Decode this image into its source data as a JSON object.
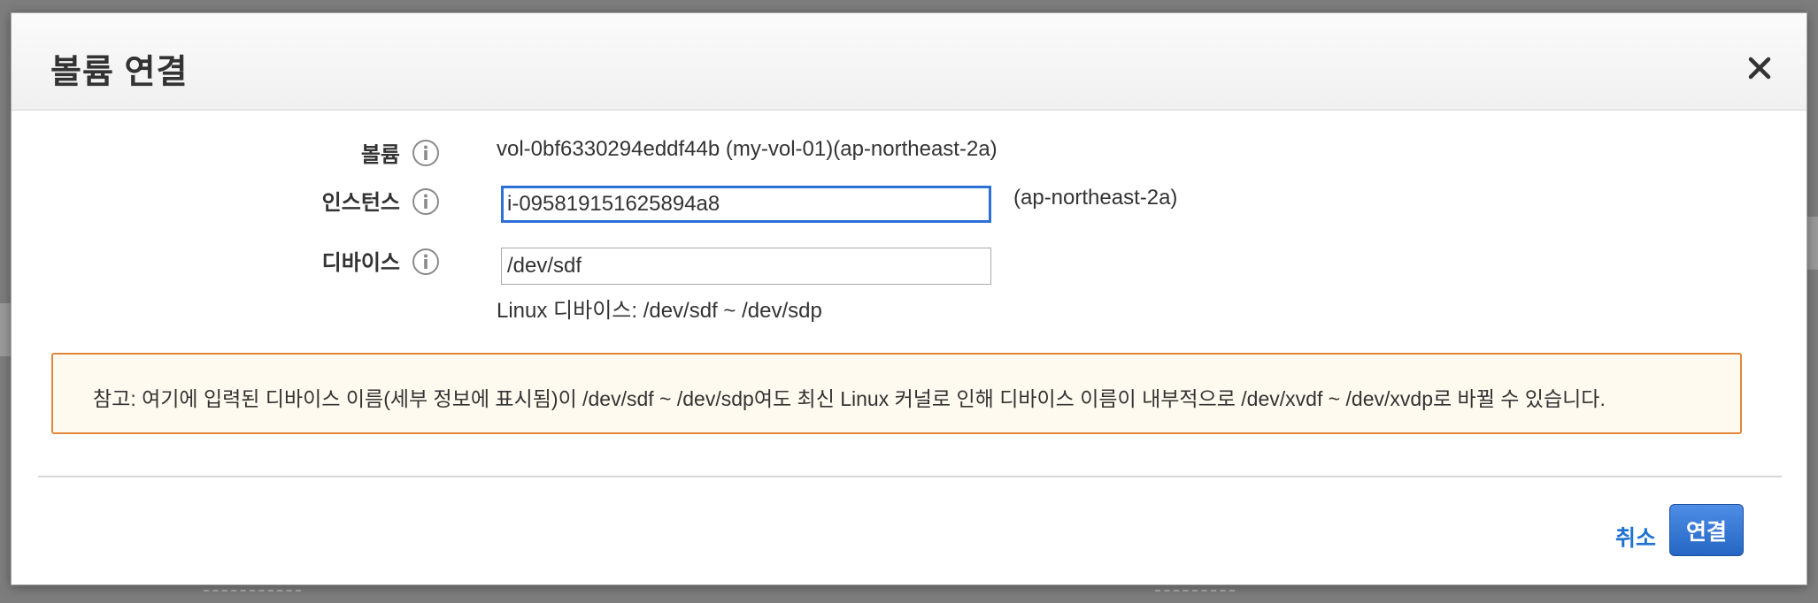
{
  "modal": {
    "title": "볼륨 연결",
    "close_label": "×"
  },
  "fields": {
    "volume": {
      "label": "볼륨",
      "value": "vol-0bf6330294eddf44b (my-vol-01)(ap-northeast-2a)"
    },
    "instance": {
      "label": "인스턴스",
      "value": "i-095819151625894a8",
      "zone": "(ap-northeast-2a)"
    },
    "device": {
      "label": "디바이스",
      "value": "/dev/sdf",
      "hint": "Linux 디바이스: /dev/sdf ~ /dev/sdp"
    }
  },
  "note": {
    "text": "참고: 여기에 입력된 디바이스 이름(세부 정보에 표시됨)이 /dev/sdf ~ /dev/sdp여도 최신 Linux 커널로 인해 디바이스 이름이 내부적으로 /dev/xvdf ~ /dev/xvdp로 바뀔 수 있습니다."
  },
  "footer": {
    "cancel_label": "취소",
    "attach_label": "연결"
  },
  "colors": {
    "accent": "#2566c4",
    "link": "#1f73d0",
    "note_border": "#e1873b",
    "note_bg": "#fffaef",
    "focus": "#2c6fd6"
  }
}
